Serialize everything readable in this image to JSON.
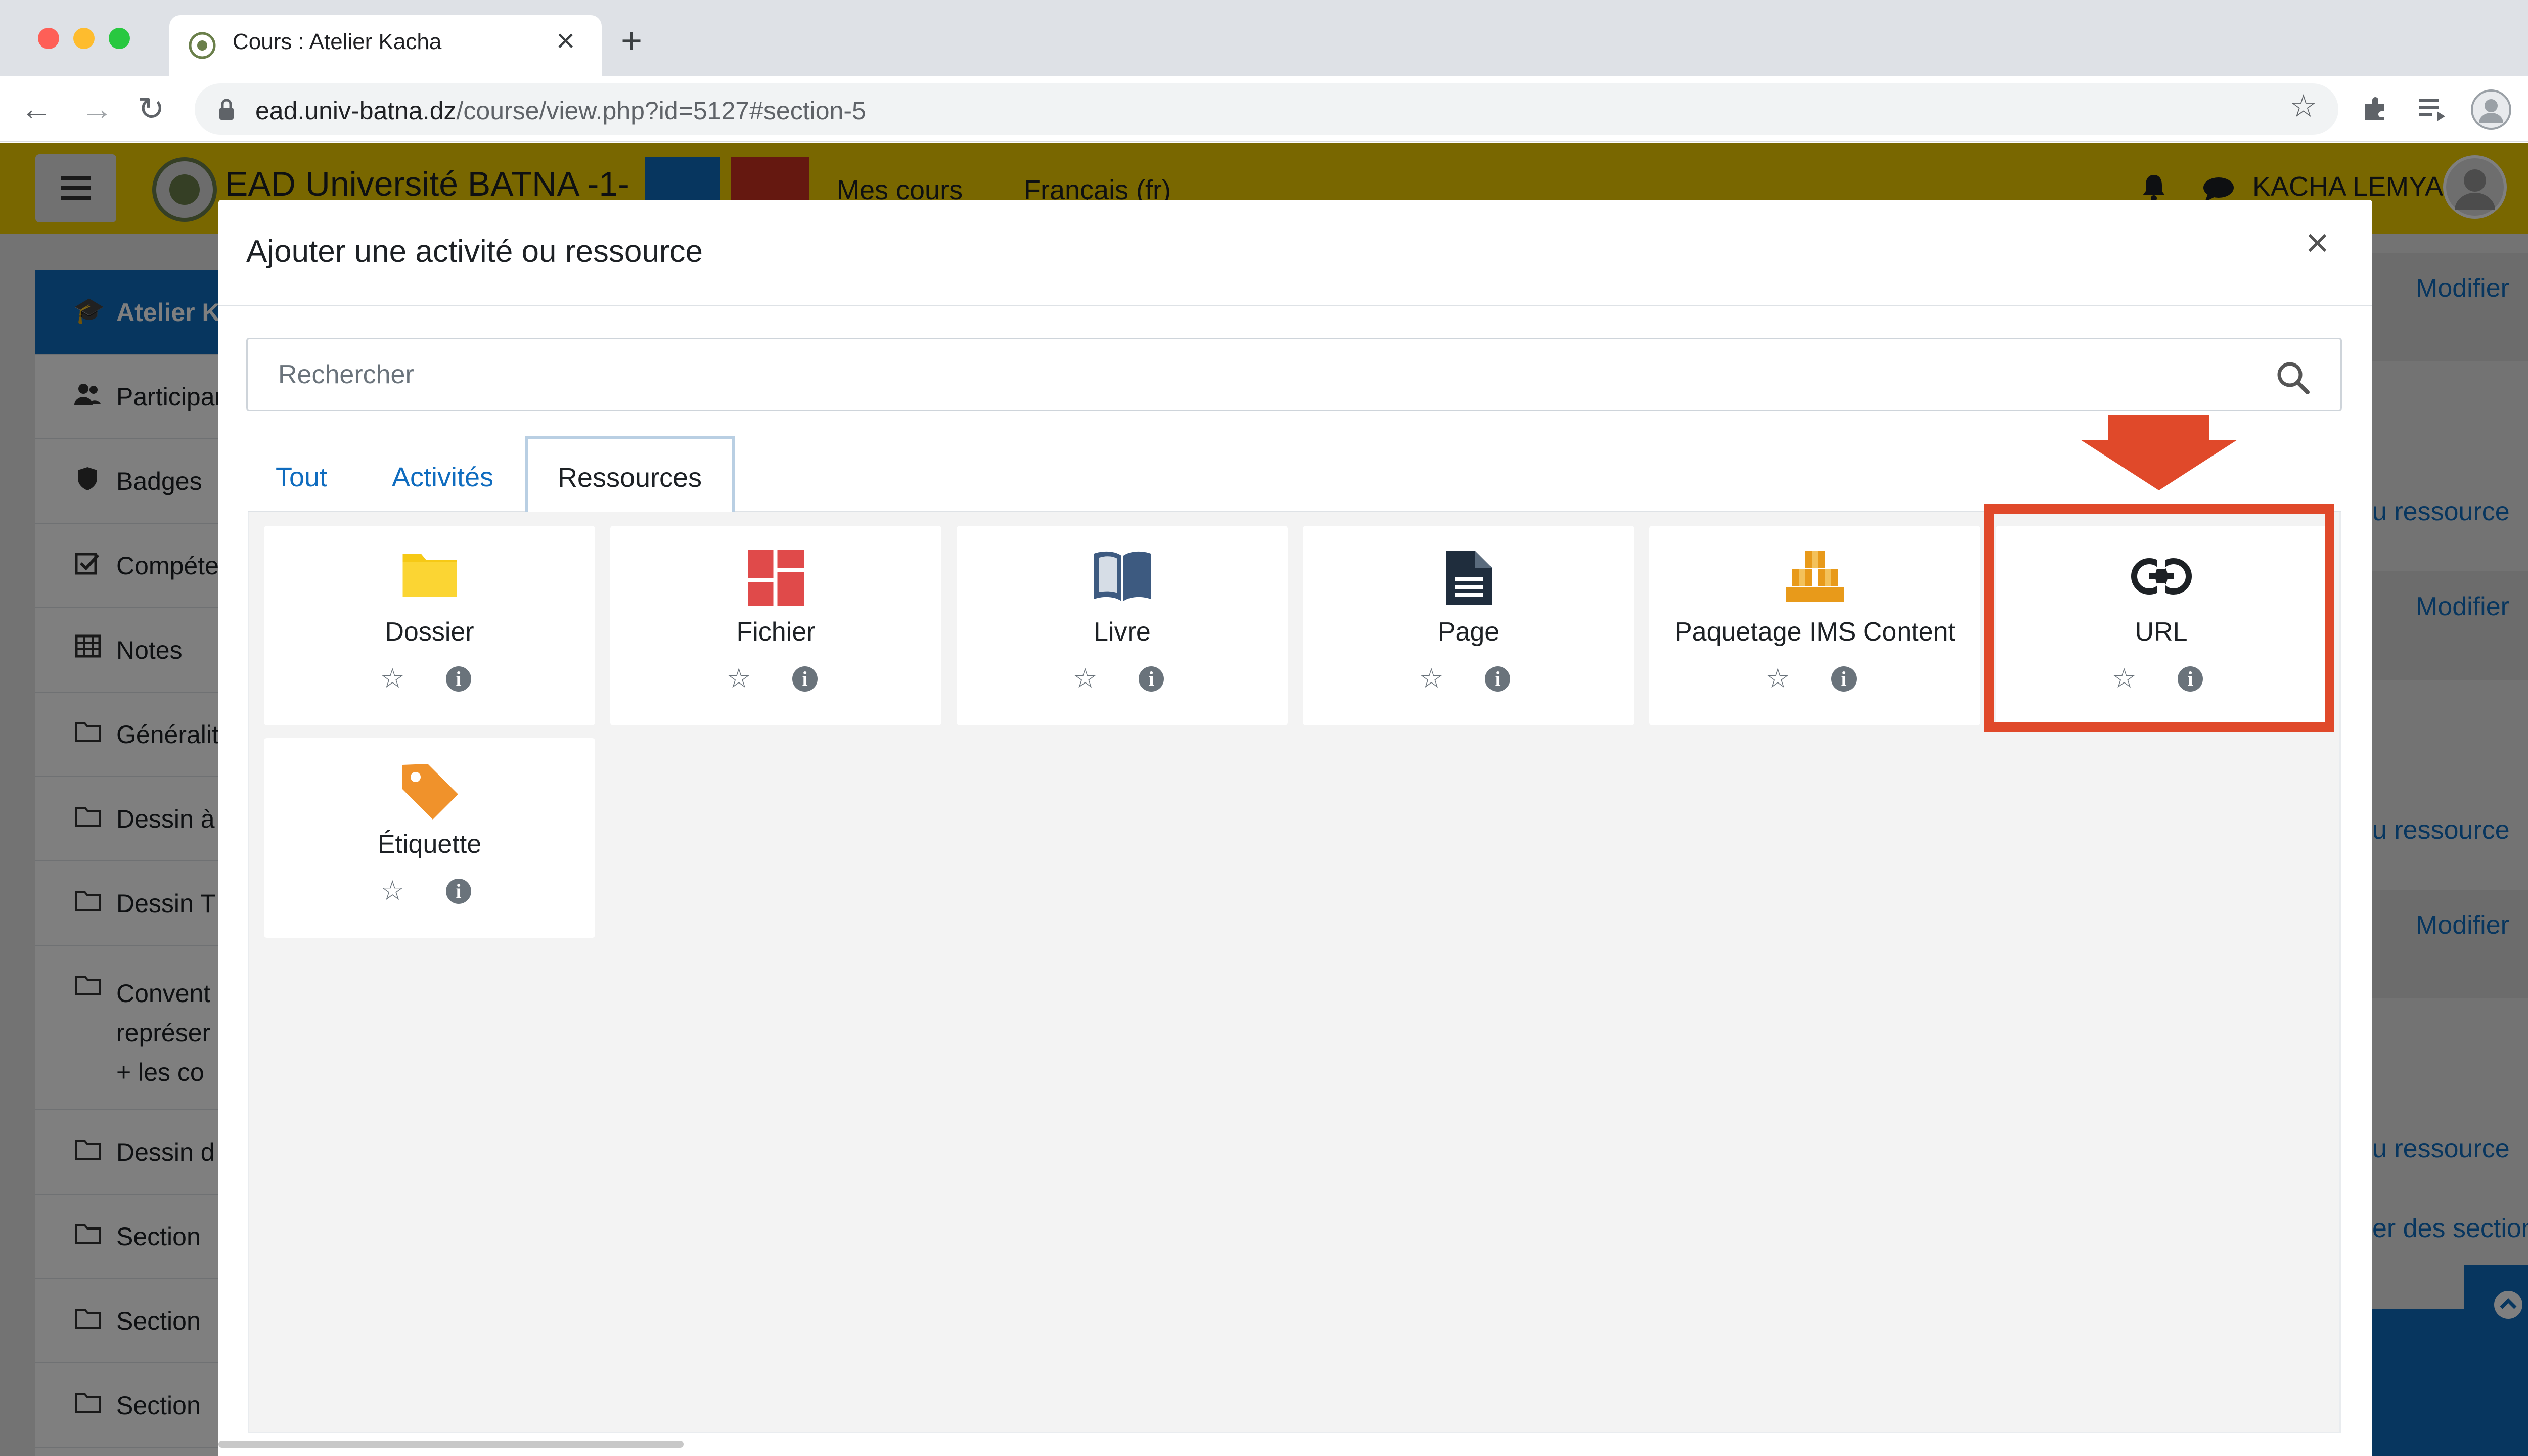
{
  "browser": {
    "tab_title": "Cours : Atelier Kacha",
    "new_tab": "+",
    "url_domain": "ead.univ-batna.dz",
    "url_path": "/course/view.php?id=5127#section-5"
  },
  "header": {
    "site_name": "EAD Université BATNA -1-",
    "menu_courses": "Mes cours",
    "menu_language": "Français (fr)",
    "user_name": "KACHA LEMYA"
  },
  "drawer": {
    "items": [
      "Atelier Kacha",
      "Participants",
      "Badges",
      "Compétences",
      "Notes",
      "Généralités",
      "Dessin à",
      "Dessin T",
      "Convent",
      "Dessin d",
      "Section",
      "Section",
      "Section"
    ],
    "item_extra_lines": [
      "représer",
      "+ les co"
    ]
  },
  "page_right": {
    "edit_label": "Modifier",
    "add_resource": "u ressource",
    "add_sections": "er des sections"
  },
  "modal": {
    "title": "Ajouter une activité ou ressource",
    "close": "×",
    "search_placeholder": "Rechercher",
    "tabs": [
      "Tout",
      "Activités",
      "Ressources"
    ],
    "active_tab": "Ressources",
    "items": [
      {
        "name": "Dossier",
        "icon": "folder-icon"
      },
      {
        "name": "Fichier",
        "icon": "file-icon"
      },
      {
        "name": "Livre",
        "icon": "book-icon"
      },
      {
        "name": "Page",
        "icon": "page-icon"
      },
      {
        "name": "Paquetage IMS Content",
        "icon": "ims-package-icon"
      },
      {
        "name": "URL",
        "icon": "link-icon"
      },
      {
        "name": "Étiquette",
        "icon": "label-tag-icon"
      }
    ],
    "star_glyph": "☆",
    "info_glyph": "i"
  },
  "annotation": {
    "highlighted_item": "URL",
    "color": "#e0492a"
  },
  "colors": {
    "header_bg": "#f3ce00",
    "link": "#0f6cbf",
    "drawer_active_bg": "#0f6cbf",
    "gear_button": "#0f6cbf",
    "power_button": "#ca3120"
  }
}
